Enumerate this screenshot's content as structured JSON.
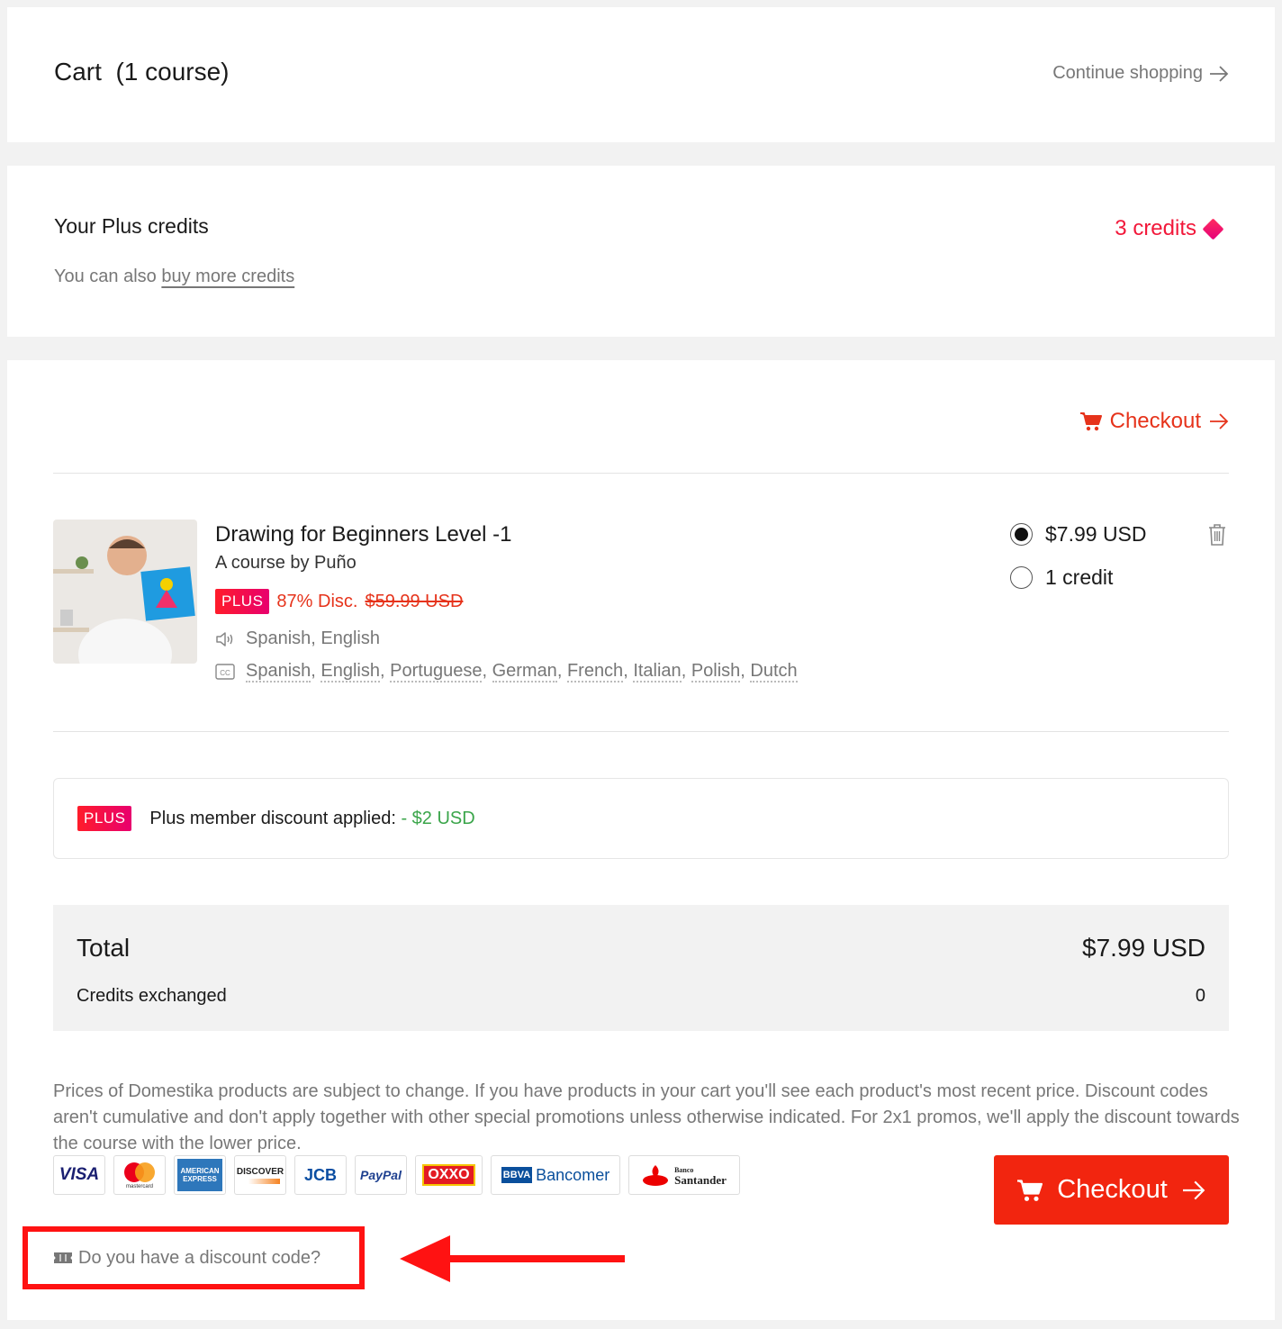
{
  "header": {
    "title": "Cart  (1 course)",
    "continue_label": "Continue shopping"
  },
  "plus_credits": {
    "title": "Your Plus credits",
    "sub_prefix": "You can also ",
    "buy_link": "buy more credits",
    "count": "3 credits"
  },
  "checkout_top": {
    "label": "Checkout"
  },
  "course": {
    "title": "Drawing for Beginners Level -1",
    "author": "A course by Puño",
    "badge": "PLUS",
    "discount": "87% Disc.",
    "old_price": "$59.99 USD",
    "audio": "Spanish, English",
    "subtitles": [
      "Spanish",
      "English",
      "Portuguese",
      "German",
      "French",
      "Italian",
      "Polish",
      "Dutch"
    ],
    "option_price": "$7.99 USD",
    "option_credit": "1 credit",
    "selected_option": "price"
  },
  "plus_discount": {
    "badge": "PLUS",
    "label": "Plus member discount applied:",
    "amount": "- $2 USD"
  },
  "total": {
    "label": "Total",
    "value": "$7.99 USD",
    "credits_label": "Credits exchanged",
    "credits_value": "0"
  },
  "disclaimer": "Prices of Domestika products are subject to change. If you have products in your cart you'll see each product's most recent price. Discount codes aren't cumulative and don't apply together with other special promotions unless otherwise indicated. For 2x1 promos, we'll apply the discount towards the course with the lower price.",
  "payment_logos": {
    "visa": "VISA",
    "mastercard": "mastercard",
    "amex": "AMERICAN EXPRESS",
    "discover": "DISCOVER",
    "jcb": "JCB",
    "paypal": "PayPal",
    "oxxo": "OXXO",
    "bbva": "BBVA",
    "bancomer": "Bancomer",
    "santander_small": "Banco",
    "santander": "Santander"
  },
  "checkout_button": {
    "label": "Checkout"
  },
  "discount_code": {
    "label": "Do you have a discount code?"
  },
  "colors": {
    "accent": "#f2250f",
    "plus_gradient_start": "#ff1c2a",
    "plus_gradient_end": "#e8006e",
    "green": "#3aa54a",
    "annotation_red": "#ff1212"
  }
}
